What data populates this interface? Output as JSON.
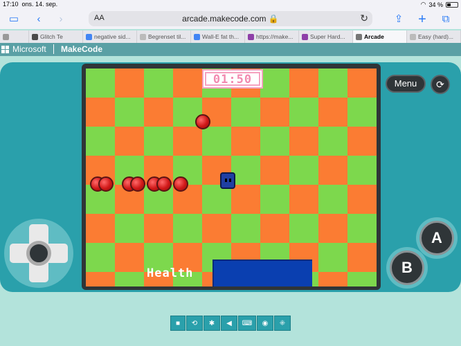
{
  "status_bar": {
    "time": "17:10",
    "date": "ons. 14. sep.",
    "wifi_icon": "wifi-icon",
    "battery": "34 %"
  },
  "browser": {
    "reader_label": "AA",
    "url": "arcade.makecode.com",
    "tabs": [
      {
        "label": "",
        "color": "#999999"
      },
      {
        "label": "Glitch Te",
        "color": "#4a4a4a"
      },
      {
        "label": "negative sid...",
        "color": "#4285f4"
      },
      {
        "label": "Begrenset til...",
        "color": "#bbbbbb"
      },
      {
        "label": "Wall-E fat th...",
        "color": "#4285f4"
      },
      {
        "label": "https://make...",
        "color": "#8e3fa8"
      },
      {
        "label": "Super Hard...",
        "color": "#8e3fa8"
      },
      {
        "label": "Arcade",
        "color": "#777777"
      },
      {
        "label": "Easy (hard)...",
        "color": "#bbbbbb"
      }
    ]
  },
  "makecode_bar": {
    "brand": "Microsoft",
    "product": "MakeCode"
  },
  "game": {
    "timer": "01:50",
    "health_label": "Health"
  },
  "controls": {
    "menu_label": "Menu",
    "a_label": "A",
    "b_label": "B",
    "bottom_icons": [
      "stop-icon",
      "restart-icon",
      "debug-icon",
      "mute-icon",
      "keyboard-icon",
      "screenshot-icon",
      "fullscreen-icon"
    ]
  }
}
